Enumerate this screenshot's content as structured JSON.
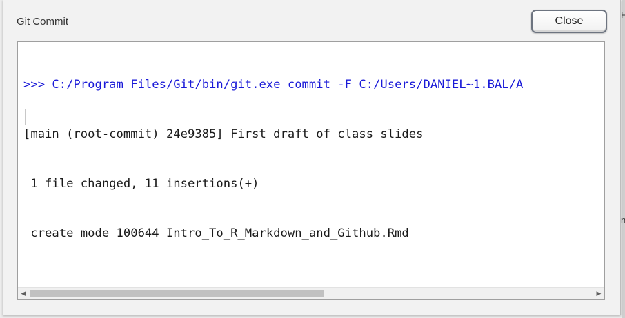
{
  "dialog": {
    "title": "Git Commit",
    "close_label": "Close"
  },
  "output": {
    "lines": [
      ">>> C:/Program Files/Git/bin/git.exe commit -F C:/Users/DANIEL~1.BAL/A",
      "[main (root-commit) 24e9385] First draft of class slides",
      " 1 file changed, 11 insertions(+)",
      " create mode 100644 Intro_To_R_Markdown_and_Github.Rmd"
    ]
  },
  "backdrop": {
    "glyph_top": "F",
    "glyph_mid": "n"
  },
  "icons": {
    "scroll_left": "scroll-left-arrow-icon",
    "scroll_right": "scroll-right-arrow-icon"
  },
  "colors": {
    "command_text": "#1a1ad8",
    "output_text": "#1a1a1a",
    "close_border": "#6d7480"
  }
}
